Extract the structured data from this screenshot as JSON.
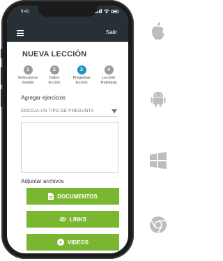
{
  "status": {
    "time": "9:41"
  },
  "header": {
    "exit_label": "Salir"
  },
  "page": {
    "title": "NUEVA LECCIÓN"
  },
  "steps": [
    {
      "number": "1",
      "label_line1": "Seleccionar",
      "label_line2": "módulo"
    },
    {
      "number": "2",
      "label_line1": "Datos",
      "label_line2": "lección"
    },
    {
      "number": "3",
      "label_line1": "Preguntas",
      "label_line2": "lección"
    },
    {
      "number": "4",
      "label_line1": "Lección",
      "label_line2": "finalizada"
    }
  ],
  "exercises": {
    "label": "Agregar ejercicios",
    "select_value": "ESCOJA UN TIPO DE PREGUNTA"
  },
  "attachments": {
    "label": "Adjuntar archivos",
    "documents_label": "DOCUMENTOS",
    "links_label": "LINKS",
    "videos_label": "VIDEOS"
  },
  "colors": {
    "header_bg": "#273035",
    "active_step": "#1f93c4",
    "button_green": "#7ab731",
    "platform_icon": "#bdbdbd"
  },
  "platforms": [
    "apple-icon",
    "android-icon",
    "windows-icon",
    "chrome-icon"
  ]
}
